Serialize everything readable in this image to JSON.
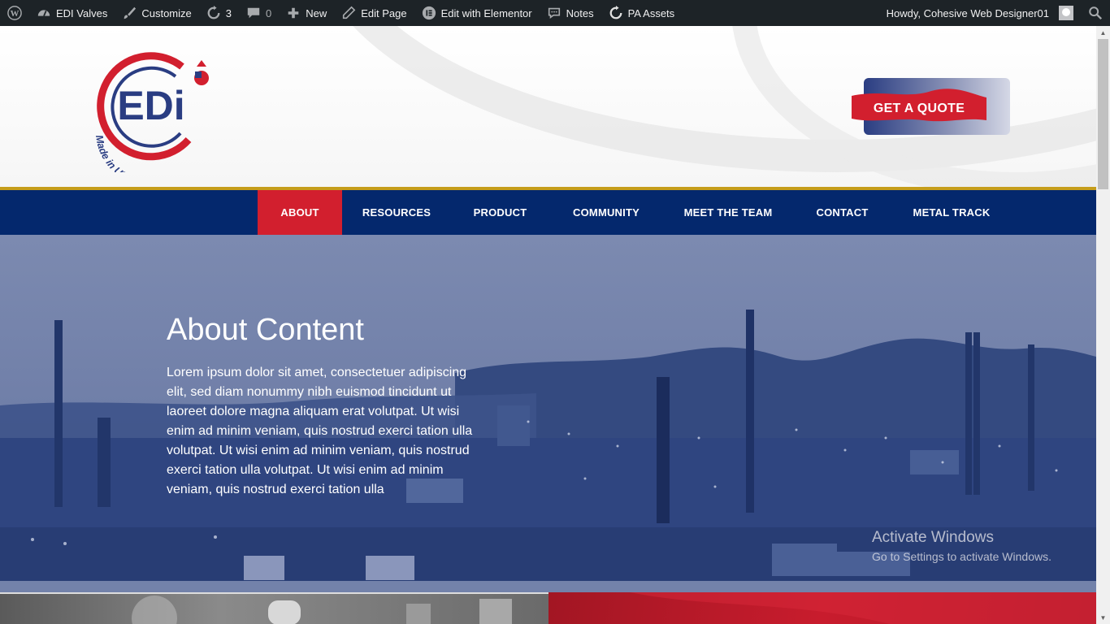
{
  "adminbar": {
    "site_name": "EDI Valves",
    "customize": "Customize",
    "updates_count": "3",
    "comments_count": "0",
    "new": "New",
    "edit_page": "Edit Page",
    "edit_elementor": "Edit with Elementor",
    "notes": "Notes",
    "pa_assets": "PA Assets",
    "howdy": "Howdy, Cohesive Web Designer01"
  },
  "header": {
    "logo_text": "EDi",
    "logo_tagline": "Made in USA Ball Valves",
    "quote_button": "GET A QUOTE"
  },
  "nav": {
    "items": [
      {
        "label": "ABOUT",
        "active": true
      },
      {
        "label": "RESOURCES",
        "active": false
      },
      {
        "label": "PRODUCT",
        "active": false
      },
      {
        "label": "COMMUNITY",
        "active": false
      },
      {
        "label": "MEET THE TEAM",
        "active": false
      },
      {
        "label": "CONTACT",
        "active": false
      },
      {
        "label": "METAL TRACK",
        "active": false
      }
    ]
  },
  "hero": {
    "title": "About Content",
    "body": "Lorem ipsum dolor sit amet, consectetuer adipiscing elit, sed diam nonummy nibh euismod tincidunt ut laoreet dolore magna aliquam erat volutpat. Ut wisi enim ad minim veniam, quis nostrud exerci tation ulla volutpat. Ut wisi enim ad minim veniam, quis nostrud exerci tation ulla volutpat. Ut wisi enim ad minim veniam, quis nostrud exerci tation ulla"
  },
  "overlay": {
    "activate_title": "Activate Windows",
    "activate_sub": "Go to Settings to activate Windows."
  },
  "colors": {
    "adminbar_bg": "#1d2327",
    "nav_bg": "#04286d",
    "nav_active": "#d21f2e",
    "nav_border": "#c59d1b",
    "brand_red": "#d21f2e",
    "brand_blue": "#2a3d82"
  }
}
